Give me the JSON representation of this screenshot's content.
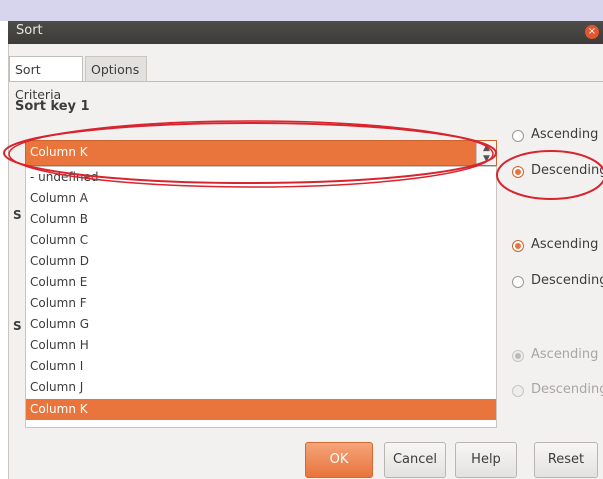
{
  "window": {
    "title": "Sort",
    "close_symbol": "×"
  },
  "tabs": [
    {
      "label": "Sort Criteria",
      "active": true
    },
    {
      "label": "Options",
      "active": false
    }
  ],
  "sort_key_1": {
    "label": "Sort key 1",
    "selected": "Column K",
    "options": [
      "- undefined -",
      "Column A",
      "Column B",
      "Column C",
      "Column D",
      "Column E",
      "Column F",
      "Column G",
      "Column H",
      "Column I",
      "Column J",
      "Column K"
    ],
    "order": {
      "ascending": "Ascending",
      "descending": "Descending",
      "value": "descending"
    }
  },
  "sort_key_2": {
    "label_partial": "S",
    "order": {
      "ascending": "Ascending",
      "descending": "Descending",
      "value": "ascending"
    }
  },
  "sort_key_3": {
    "label_partial": "S",
    "order": {
      "ascending": "Ascending",
      "descending": "Descending",
      "value": "ascending",
      "disabled": true
    }
  },
  "buttons": {
    "ok": "OK",
    "cancel": "Cancel",
    "help": "Help",
    "reset": "Reset"
  },
  "colors": {
    "accent": "#e9743c",
    "annotation": "#d9232d",
    "titlebar": "#3c3b37"
  }
}
